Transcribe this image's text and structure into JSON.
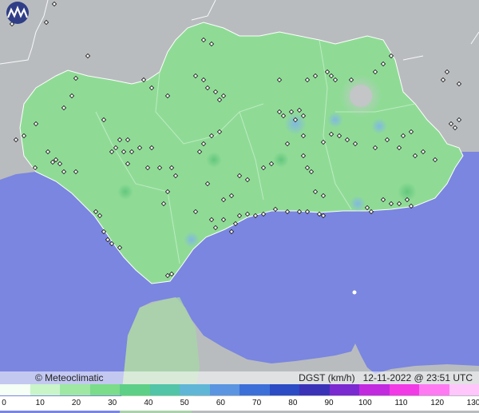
{
  "brand": "© Meteoclimatic",
  "variable": "DGST (km/h)",
  "timestamp": "12-11-2022 @ 23:51 UTC",
  "scale": {
    "labels": [
      "0",
      "10",
      "20",
      "30",
      "40",
      "50",
      "60",
      "70",
      "80",
      "90",
      "100",
      "110",
      "120",
      "130"
    ],
    "colors": [
      "#f5fff5",
      "#c9f5c9",
      "#9ee8a3",
      "#7bdc8a",
      "#5ecf86",
      "#52c4a8",
      "#60b6d6",
      "#5b94e0",
      "#3d6fd8",
      "#2b4cc4",
      "#3a33b8",
      "#7a2ad0",
      "#c22ae0",
      "#f23ae6",
      "#ff7af2",
      "#ffc6fb"
    ]
  },
  "colors": {
    "sea": "#7a86df",
    "land_other": "#b9bcbf",
    "andalusia": "#8fdb96"
  }
}
